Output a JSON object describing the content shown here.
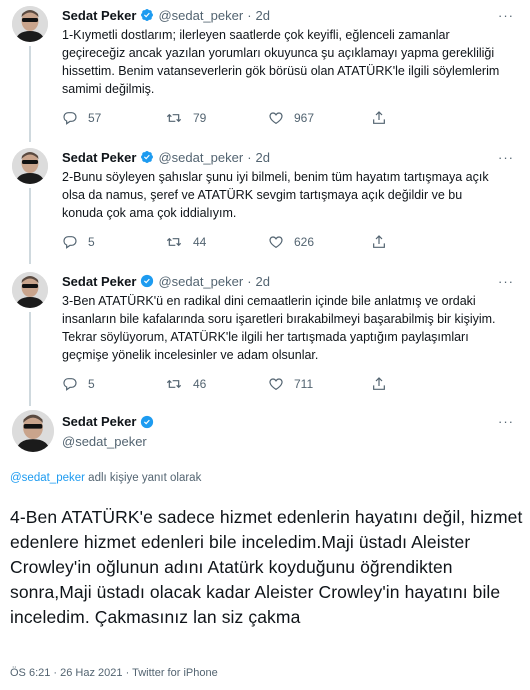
{
  "colors": {
    "accent": "#1d9bf0",
    "text": "#0f1419",
    "muted": "#536471",
    "thread": "#cfd9de"
  },
  "thread_tweets": [
    {
      "name": "Sedat Peker",
      "handle": "@sedat_peker",
      "dot": "·",
      "time": "2d",
      "more": "···",
      "text": "1-Kıymetli dostlarım; ilerleyen saatlerde çok keyifli, eğlenceli zamanlar geçireceğiz ancak yazılan yorumları okuyunca şu açıklamayı yapma gerekliliği hissettim. Benim vatanseverlerin gök börüsü olan ATATÜRK'le ilgili söylemlerim samimi değilmiş.",
      "replies": "57",
      "retweets": "79",
      "likes": "967"
    },
    {
      "name": "Sedat Peker",
      "handle": "@sedat_peker",
      "dot": "·",
      "time": "2d",
      "more": "···",
      "text": "2-Bunu söyleyen şahıslar şunu iyi bilmeli, benim tüm hayatım tartışmaya açık olsa da namus, şeref ve ATATÜRK sevgim tartışmaya açık değildir ve bu konuda çok ama çok iddialıyım.",
      "replies": "5",
      "retweets": "44",
      "likes": "626"
    },
    {
      "name": "Sedat Peker",
      "handle": "@sedat_peker",
      "dot": "·",
      "time": "2d",
      "more": "···",
      "text": "3-Ben ATATÜRK'ü en radikal dini cemaatlerin içinde bile anlatmış ve ordaki insanların bile kafalarında soru işaretleri bırakabilmeyi başarabilmiş bir kişiyim. Tekrar söylüyorum, ATATÜRK'le ilgili her tartışmada yaptığım paylaşımları geçmişe yönelik incelesinler ve adam olsunlar.",
      "replies": "5",
      "retweets": "46",
      "likes": "711"
    }
  ],
  "main_tweet": {
    "name": "Sedat Peker",
    "handle": "@sedat_peker",
    "more": "···",
    "reply_mention": "@sedat_peker",
    "reply_suffix": " adlı kişiye yanıt olarak",
    "text": "4-Ben ATATÜRK'e sadece hizmet edenlerin hayatını değil, hizmet edenlere hizmet edenleri bile inceledim.Maji üstadı Aleister Crowley'in oğlunun adını Atatürk koyduğunu öğrendikten sonra,Maji üstadı olacak kadar Aleister Crowley'in hayatını bile inceledim. Çakmasınız lan siz çakma",
    "time": "ÖS 6:21",
    "date": "26 Haz 2021",
    "source": "Twitter for iPhone",
    "sep": " · "
  }
}
